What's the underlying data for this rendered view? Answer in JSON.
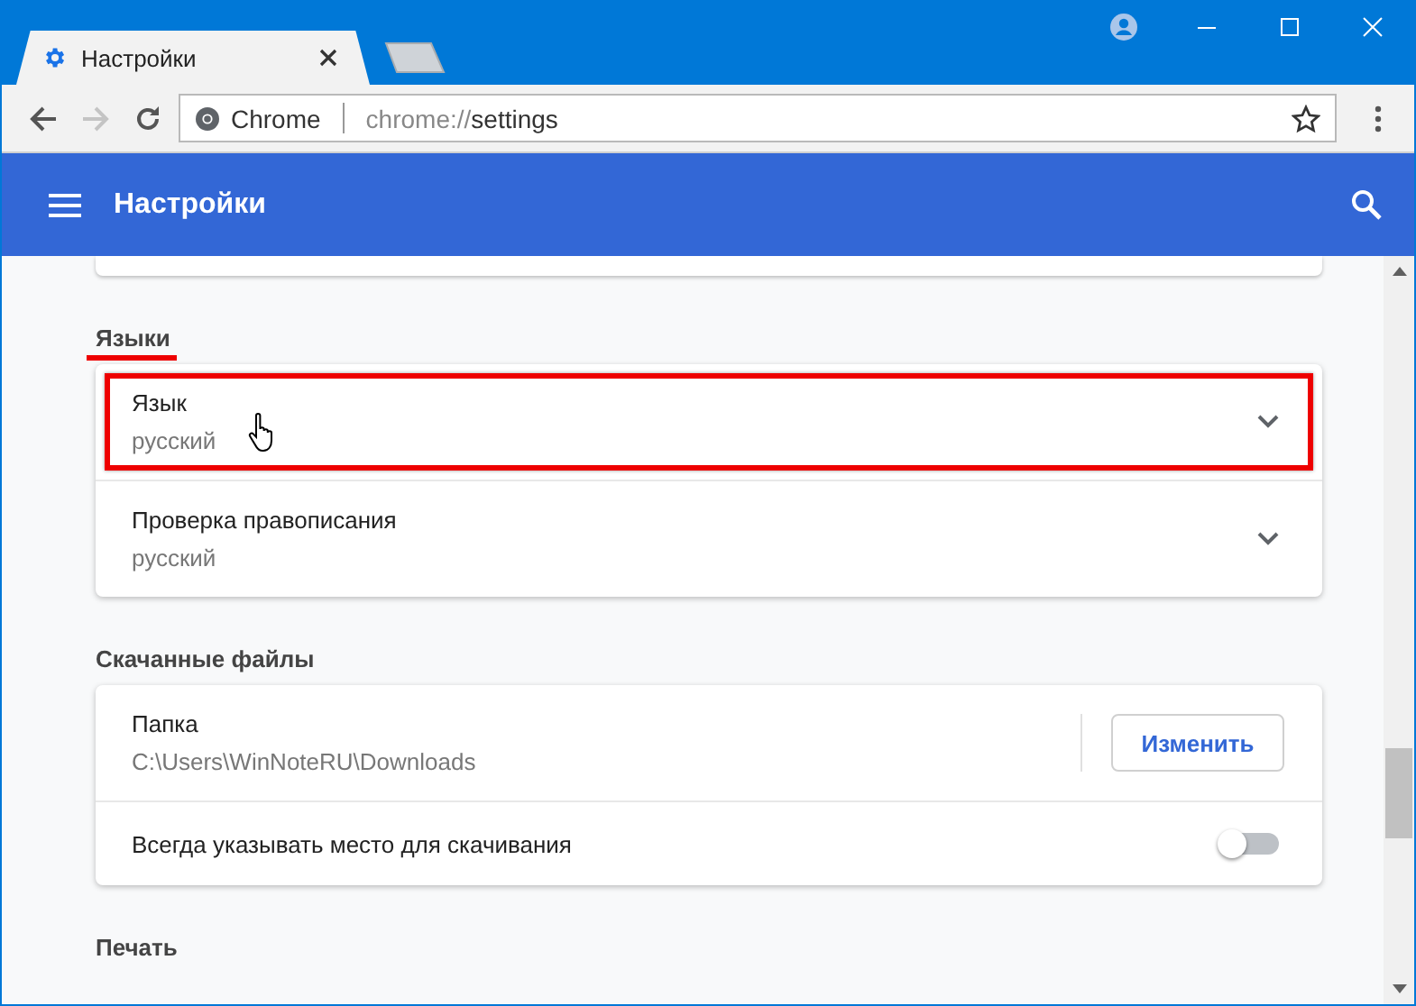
{
  "window": {
    "tabs": [
      {
        "label": "Настройки",
        "kind": "settings",
        "selected": true
      },
      {
        "kind": "new",
        "selected": false
      }
    ]
  },
  "address_bar": {
    "site_label": "Chrome",
    "scheme": "chrome://",
    "path": "settings"
  },
  "header": {
    "title": "Настройки"
  },
  "sections": [
    {
      "heading": "Языки",
      "underlined": true,
      "rows": [
        {
          "kind": "expand",
          "title": "Язык",
          "value": "русский",
          "highlighted": true,
          "pointer": true
        },
        {
          "kind": "expand",
          "title": "Проверка правописания",
          "value": "русский",
          "highlighted": false,
          "pointer": false
        }
      ]
    },
    {
      "heading": "Скачанные файлы",
      "underlined": false,
      "rows": [
        {
          "kind": "button",
          "title": "Папка",
          "value": "C:\\Users\\WinNoteRU\\Downloads",
          "button": "Изменить"
        },
        {
          "kind": "toggle",
          "title": "Всегда указывать место для скачивания",
          "on": false
        }
      ]
    },
    {
      "heading": "Печать",
      "underlined": false
    }
  ]
}
